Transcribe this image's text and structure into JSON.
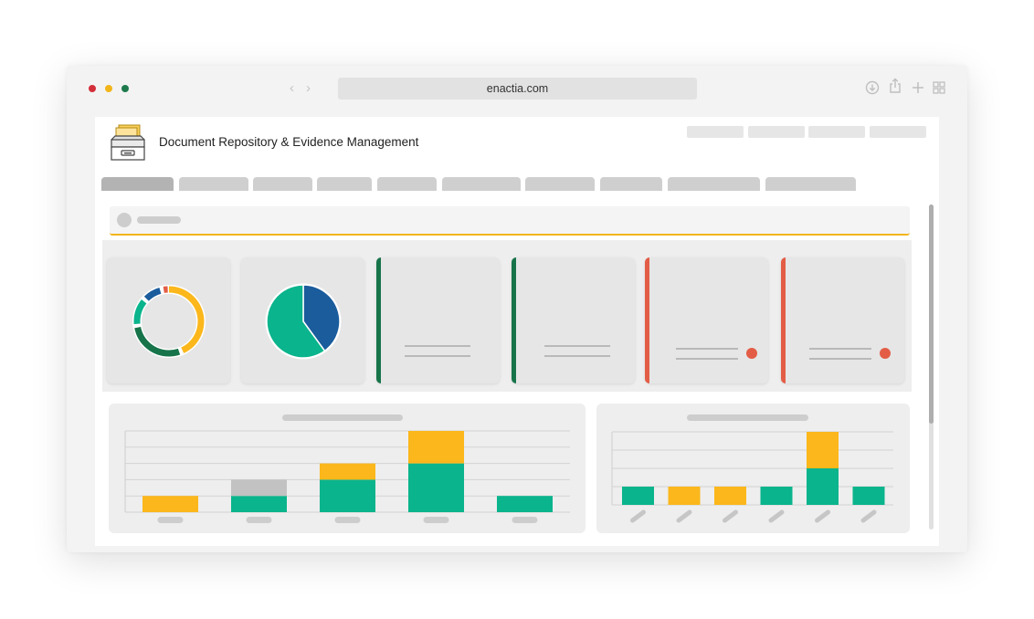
{
  "browser": {
    "url": "enactia.com",
    "traffic_lights": [
      "#d32f3b",
      "#f2b51a",
      "#1d7a4c"
    ],
    "toolbar_icons": [
      "download-icon",
      "share-icon",
      "plus-icon",
      "grid-icon"
    ]
  },
  "app": {
    "title": "Document Repository & Evidence Management",
    "logo_icon": "file-drawer-icon",
    "colors": {
      "yellow": "#fbb71b",
      "teal": "#0ab48c",
      "dark_green": "#17744a",
      "blue": "#1a5c9c",
      "red": "#e35d46",
      "gray_segment": "#c2c2c2"
    }
  },
  "summary_cards": {
    "donut": {
      "segments": [
        {
          "color": "#fbb71b",
          "percent": 43
        },
        {
          "color": "#17744a",
          "percent": 27
        },
        {
          "color": "#0ab48c",
          "percent": 12
        },
        {
          "color": "#1a5c9c",
          "percent": 8
        },
        {
          "color": "#e35d46",
          "percent": 2
        }
      ]
    },
    "pie": {
      "segments": [
        {
          "color": "#1a5c9c",
          "percent": 40
        },
        {
          "color": "#0ab48c",
          "percent": 60
        }
      ]
    },
    "stat_cards": [
      {
        "accent": "#17744a",
        "alert": false
      },
      {
        "accent": "#17744a",
        "alert": false
      },
      {
        "accent": "#e35d46",
        "alert": true
      },
      {
        "accent": "#e35d46",
        "alert": true
      }
    ]
  },
  "chart_data": [
    {
      "type": "bar",
      "stacked": true,
      "categories": [
        "",
        "",
        "",
        "",
        ""
      ],
      "series": [
        {
          "color": "#0ab48c",
          "values": [
            0,
            1,
            2,
            3,
            1
          ]
        },
        {
          "color": "#c2c2c2",
          "values": [
            0,
            1,
            0,
            0,
            0
          ]
        },
        {
          "color": "#fbb71b",
          "values": [
            1,
            0,
            1,
            2,
            0
          ]
        }
      ],
      "ylim": [
        0,
        5
      ],
      "grid": true
    },
    {
      "type": "bar",
      "stacked": true,
      "categories": [
        "",
        "",
        "",
        "",
        "",
        ""
      ],
      "series": [
        {
          "color": "#0ab48c",
          "values": [
            1,
            0,
            0,
            1,
            2,
            1
          ]
        },
        {
          "color": "#fbb71b",
          "values": [
            0,
            1,
            1,
            0,
            2,
            0
          ]
        }
      ],
      "ylim": [
        0,
        4
      ],
      "grid": true
    }
  ]
}
